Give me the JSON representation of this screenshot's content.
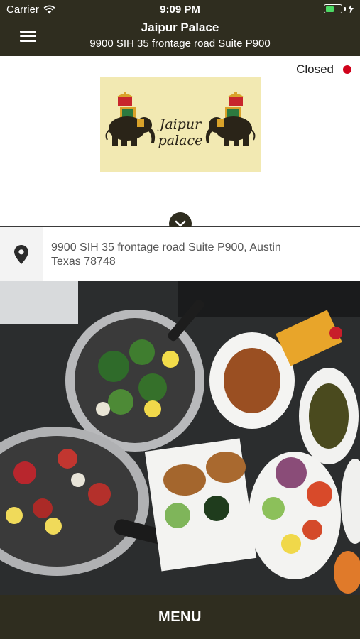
{
  "status_bar": {
    "carrier": "Carrier",
    "time": "9:09 PM",
    "wifi_icon": "wifi-icon",
    "battery_icon": "battery-icon",
    "charging_icon": "bolt-icon",
    "battery_level_fraction": 0.55
  },
  "header": {
    "title": "Jaipur Palace",
    "subtitle": "9900 SIH 35 frontage road Suite P900",
    "menu_icon": "hamburger-icon",
    "background": "#2f2d1f"
  },
  "hours": {
    "status_text": "Closed",
    "status_color": "#d0021b"
  },
  "logo": {
    "line1": "Jaipur",
    "line2": "palace",
    "background": "#f2e9b2"
  },
  "expand_icon": "chevron-down-icon",
  "address": {
    "icon": "map-pin-icon",
    "line1": "9900 SIH 35 frontage road Suite P900, Austin",
    "line2": "Texas 78748"
  },
  "photo": {
    "subject": "food-photo"
  },
  "bottom_bar": {
    "label": "MENU"
  }
}
